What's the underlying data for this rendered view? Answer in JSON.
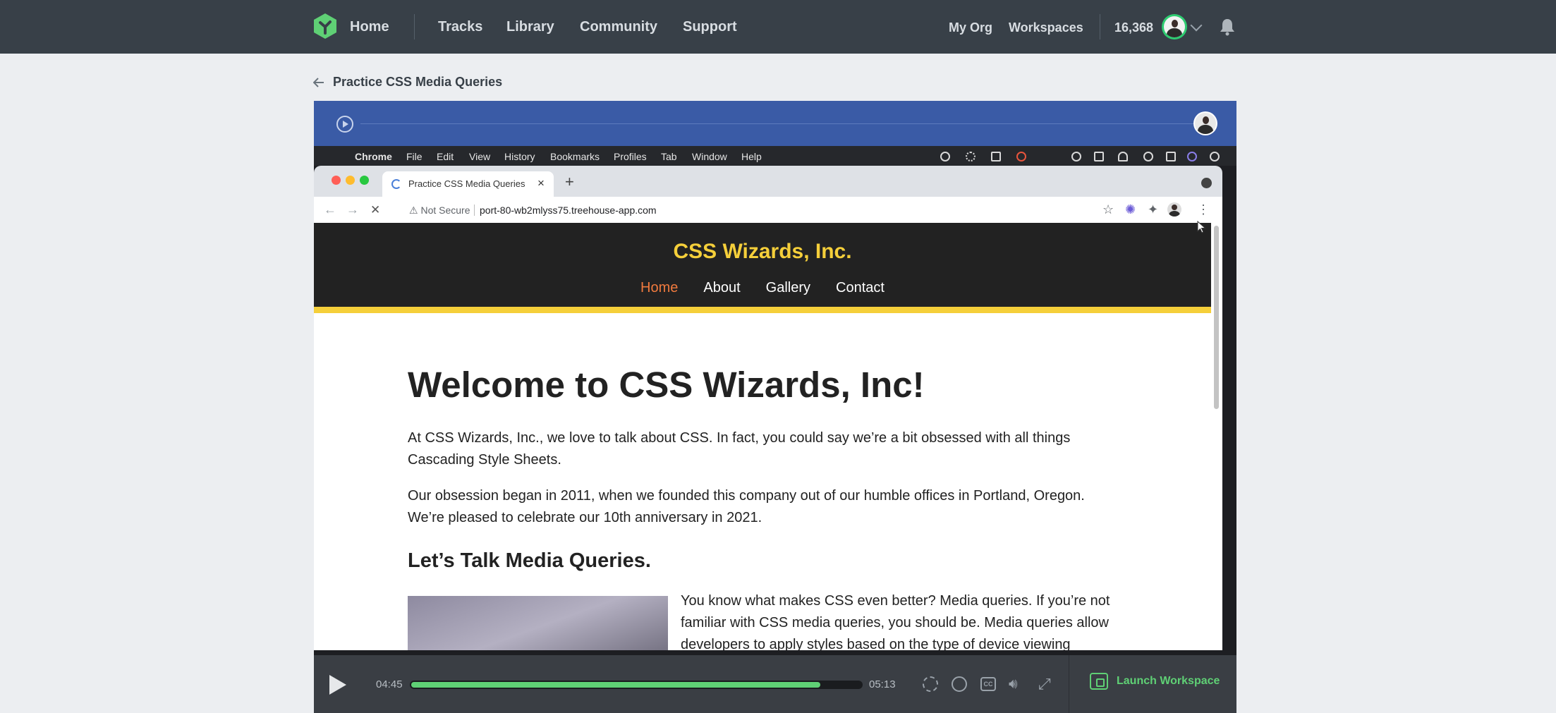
{
  "topnav": {
    "home": "Home",
    "tracks": "Tracks",
    "library": "Library",
    "community": "Community",
    "support": "Support",
    "my_org": "My Org",
    "workspaces": "Workspaces",
    "points": "16,368"
  },
  "breadcrumb": {
    "title": "Practice CSS Media Queries"
  },
  "mac_menu": [
    "Chrome",
    "File",
    "Edit",
    "View",
    "History",
    "Bookmarks",
    "Profiles",
    "Tab",
    "Window",
    "Help"
  ],
  "browser": {
    "tab_title": "Practice CSS Media Queries",
    "not_secure": "Not Secure",
    "url": "port-80-wb2mlyss75.treehouse-app.com"
  },
  "site": {
    "title": "CSS Wizards, Inc.",
    "nav": [
      "Home",
      "About",
      "Gallery",
      "Contact"
    ],
    "heading": "Welcome to CSS Wizards, Inc!",
    "para1": "At CSS Wizards, Inc., we love to talk about CSS. In fact, you could say we’re a bit obsessed with all things Cascading Style Sheets.",
    "para2": "Our obsession began in 2011, when we founded this company out of our humble offices in Portland, Oregon. We’re pleased to celebrate our 10th anniversary in 2021.",
    "subheading": "Let’s Talk Media Queries.",
    "para3": "You know what makes CSS even better? Media queries. If you’re not familiar with CSS media queries, you should be. Media queries allow developers to apply styles based on the type of device viewing"
  },
  "player": {
    "current_time": "04:45",
    "duration": "05:13",
    "progress": 0.91,
    "launch_label": "Launch Workspace",
    "cc_label": "CC"
  },
  "colors": {
    "nav_bg": "#384048",
    "player_top": "#3a5ba6",
    "accent_green": "#5fd075",
    "site_yellow": "#f5cf3a",
    "site_active": "#f07a3e"
  }
}
